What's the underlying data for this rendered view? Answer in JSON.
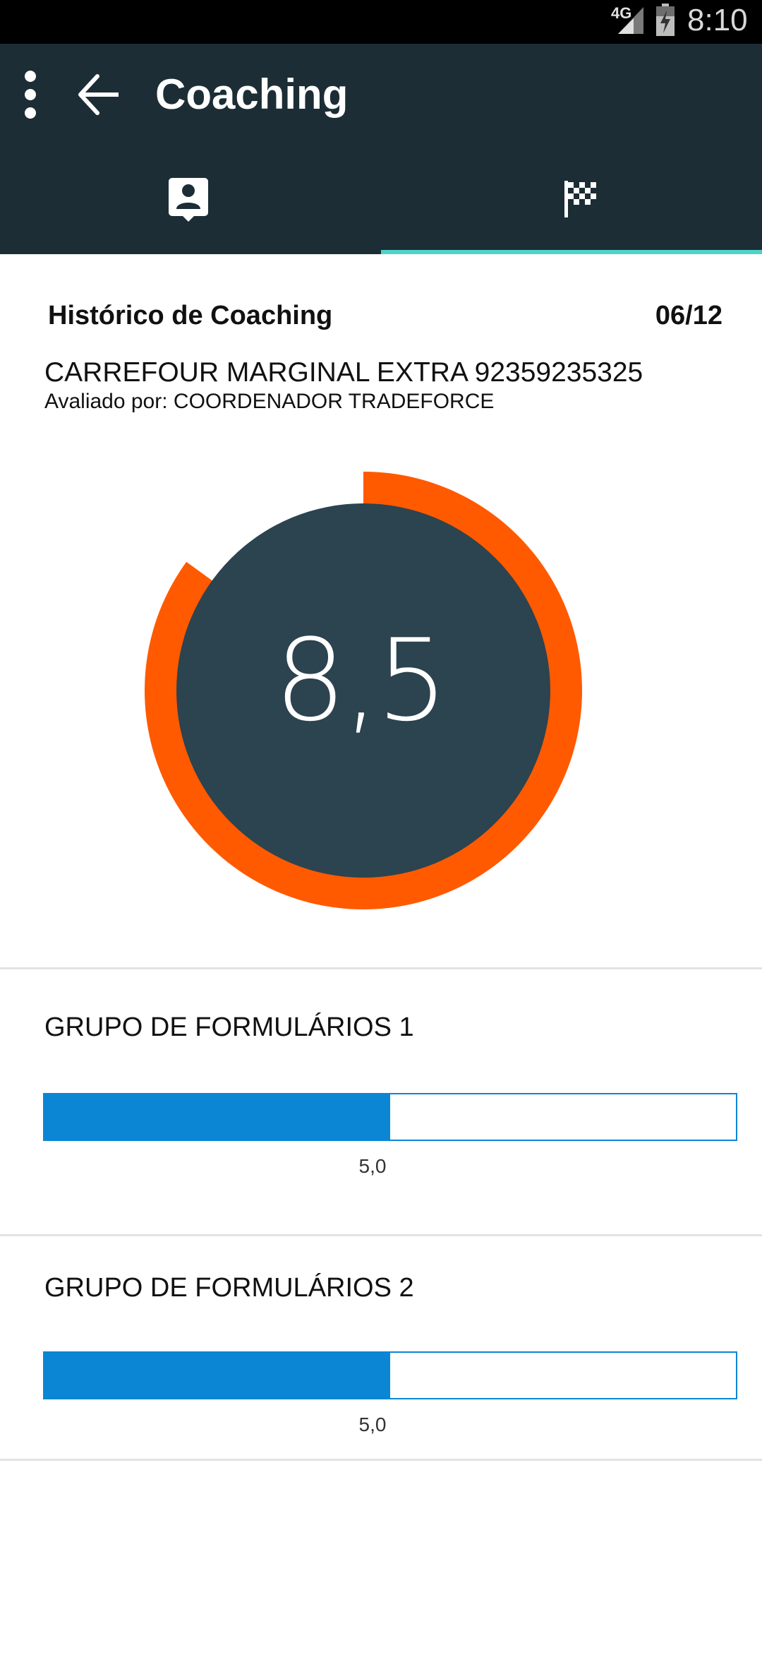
{
  "status_bar": {
    "network": "4G",
    "time": "8:10"
  },
  "app_bar": {
    "title": "Coaching",
    "tabs": [
      {
        "icon": "contact-card-icon",
        "selected": false
      },
      {
        "icon": "checkered-flag-icon",
        "selected": true
      }
    ],
    "colors": {
      "background": "#1c2d35",
      "tab_indicator": "#4fd3c8"
    }
  },
  "header": {
    "title": "Histórico de Coaching",
    "date": "06/12",
    "store": "CARREFOUR MARGINAL EXTRA 92359235325",
    "evaluator": "Avaliado por: COORDENADOR TRADEFORCE"
  },
  "score": {
    "value_text": "8,5",
    "value": 8.5,
    "max": 10,
    "colors": {
      "ring": "#ff5a00",
      "center": "#2c4350"
    }
  },
  "groups": [
    {
      "title": "GRUPO DE FORMULÁRIOS 1",
      "value_text": "5,0",
      "value": 5.0,
      "max": 10
    },
    {
      "title": "GRUPO DE FORMULÁRIOS 2",
      "value_text": "5,0",
      "value": 5.0,
      "max": 10
    }
  ],
  "colors": {
    "progress": "#0b86d4"
  }
}
